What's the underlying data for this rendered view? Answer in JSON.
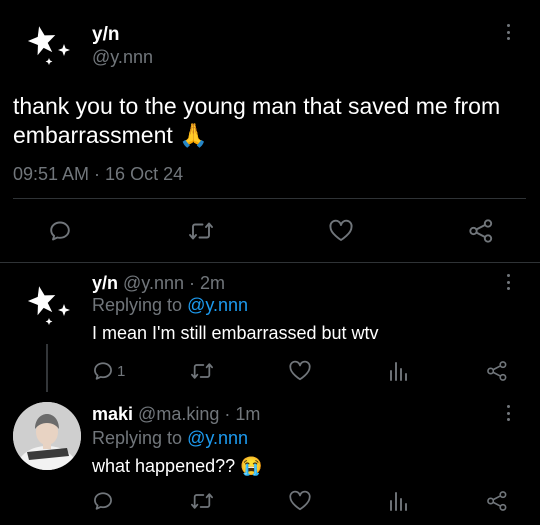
{
  "main_tweet": {
    "display_name": "y/n",
    "handle": "@y.nnn",
    "text": "thank you to the young man that saved me from embarrassment",
    "emoji": "🙏",
    "timestamp": "09:51 AM · 16 Oct 24"
  },
  "replies": [
    {
      "display_name": "y/n",
      "handle_time": "@y.nnn · 2m",
      "replying_label": "Replying to",
      "replying_handle": "@y.nnn",
      "text": "I mean I'm still embarrassed but wtv",
      "reply_count": "1"
    },
    {
      "display_name": "maki",
      "handle_time": "@ma.king · 1m",
      "replying_label": "Replying to",
      "replying_handle": "@y.nnn",
      "text": "what happened??",
      "emoji": "😭",
      "reply_count": ""
    }
  ],
  "icons": {
    "avatar": "sparkle-stars-icon",
    "reply": "speech-bubble-icon",
    "retweet": "retweet-icon",
    "like": "heart-icon",
    "views": "bar-chart-icon",
    "share": "share-nodes-icon",
    "more": "vertical-dots-icon"
  },
  "colors": {
    "background": "#000000",
    "text": "#ffffff",
    "muted": "#71767b",
    "link": "#1d9bf0",
    "divider": "#2f3336"
  }
}
